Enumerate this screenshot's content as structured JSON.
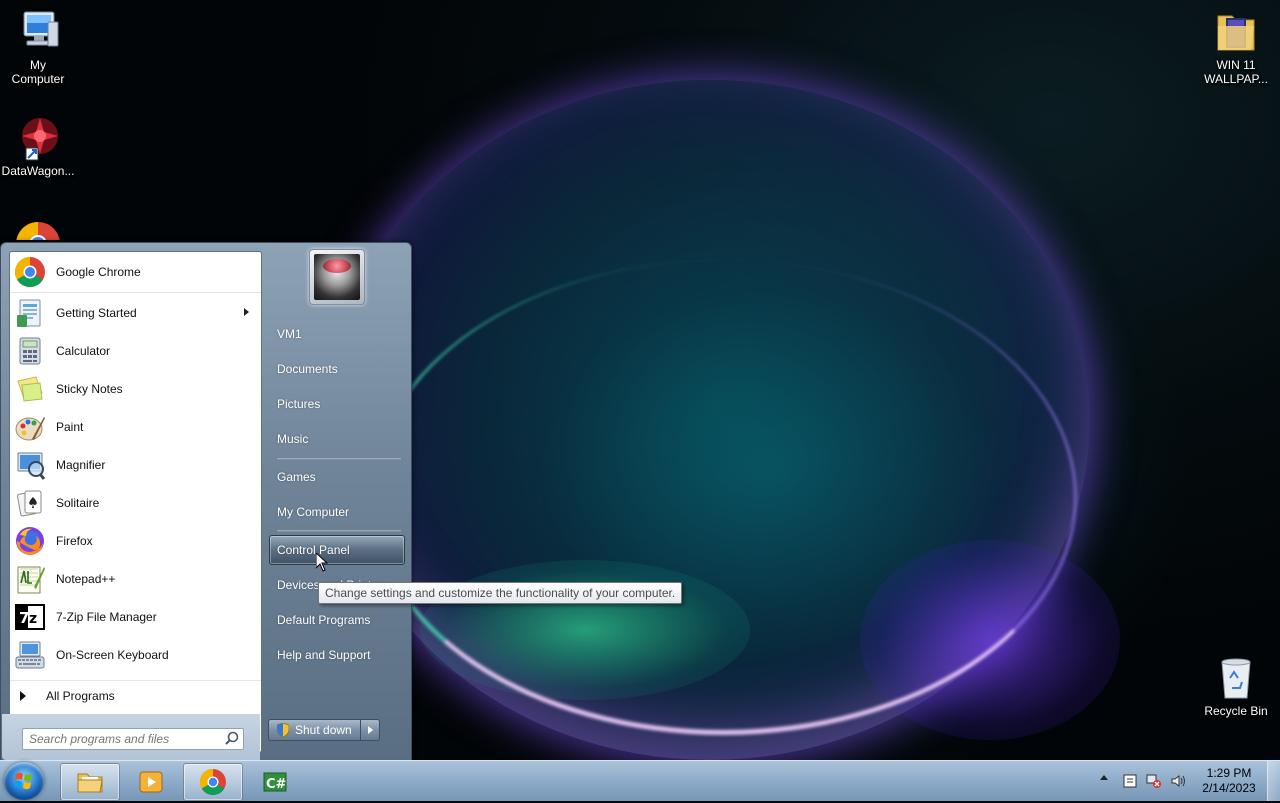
{
  "desktop": {
    "icons": [
      {
        "label": "My\nComputer",
        "icon": "computer-icon"
      },
      {
        "label": "DataWagon...",
        "icon": "datawagon-icon"
      },
      {
        "label": "WIN 11\nWALLPAP...",
        "icon": "folder-icon"
      },
      {
        "label": "Recycle Bin",
        "icon": "recycle-bin-icon"
      }
    ]
  },
  "start_menu": {
    "programs": [
      {
        "label": "Google Chrome",
        "icon": "chrome-icon"
      },
      {
        "label": "Getting Started",
        "icon": "getting-started-icon",
        "has_submenu": true
      },
      {
        "label": "Calculator",
        "icon": "calculator-icon"
      },
      {
        "label": "Sticky Notes",
        "icon": "sticky-notes-icon"
      },
      {
        "label": "Paint",
        "icon": "paint-icon"
      },
      {
        "label": "Magnifier",
        "icon": "magnifier-icon"
      },
      {
        "label": "Solitaire",
        "icon": "solitaire-icon"
      },
      {
        "label": "Firefox",
        "icon": "firefox-icon"
      },
      {
        "label": "Notepad++",
        "icon": "notepadpp-icon"
      },
      {
        "label": "7-Zip File Manager",
        "icon": "7zip-icon"
      },
      {
        "label": "On-Screen Keyboard",
        "icon": "keyboard-icon"
      }
    ],
    "all_programs": "All Programs",
    "search_placeholder": "Search programs and files",
    "right": {
      "user": "VM1",
      "documents": "Documents",
      "pictures": "Pictures",
      "music": "Music",
      "games": "Games",
      "my_computer": "My Computer",
      "control_panel": "Control Panel",
      "devices_printers": "Devices and Printers",
      "default_programs": "Default Programs",
      "help_support": "Help and Support"
    },
    "shutdown": "Shut down",
    "tooltip": "Change settings and customize the functionality of your computer."
  },
  "taskbar": {
    "pinned": [
      {
        "name": "explorer",
        "icon": "folder-icon"
      },
      {
        "name": "media-player",
        "icon": "media-player-icon"
      },
      {
        "name": "chrome",
        "icon": "chrome-icon",
        "active": true
      },
      {
        "name": "csharp",
        "icon": "csharp-icon"
      }
    ],
    "clock_time": "1:29 PM",
    "clock_date": "2/14/2023"
  },
  "colors": {
    "accent": "#5a6e83",
    "taskbar": "#96b4d2"
  }
}
